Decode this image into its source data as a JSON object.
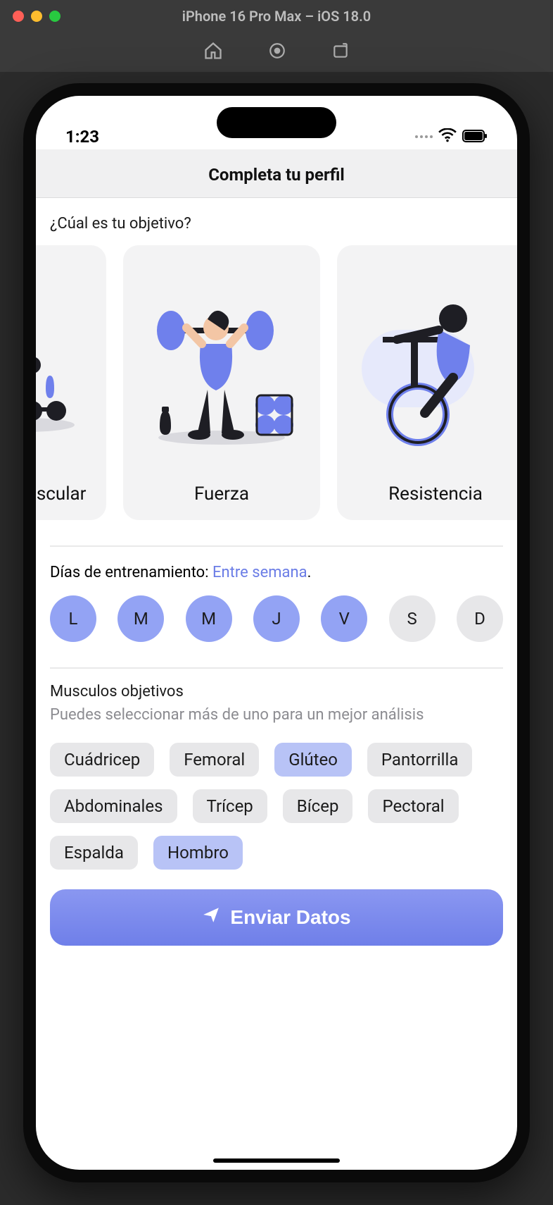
{
  "simulator": {
    "title": "iPhone 16 Pro Max – iOS 18.0"
  },
  "status": {
    "time": "1:23"
  },
  "header": {
    "title": "Completa tu perfil"
  },
  "objective": {
    "question": "¿Cúal es tu objetivo?",
    "cards": [
      {
        "label": "Ganancia muscular"
      },
      {
        "label": "Fuerza"
      },
      {
        "label": "Resistencia"
      }
    ]
  },
  "days": {
    "label_prefix": "Días de entrenamiento: ",
    "label_highlight": "Entre semana",
    "label_suffix": ".",
    "items": [
      {
        "letter": "L",
        "selected": true
      },
      {
        "letter": "M",
        "selected": true
      },
      {
        "letter": "M",
        "selected": true
      },
      {
        "letter": "J",
        "selected": true
      },
      {
        "letter": "V",
        "selected": true
      },
      {
        "letter": "S",
        "selected": false
      },
      {
        "letter": "D",
        "selected": false
      }
    ]
  },
  "muscles": {
    "title": "Musculos objetivos",
    "subtitle": "Puedes seleccionar más de uno para un mejor análisis",
    "items": [
      {
        "label": "Cuádricep",
        "selected": false
      },
      {
        "label": "Femoral",
        "selected": false
      },
      {
        "label": "Glúteo",
        "selected": true
      },
      {
        "label": "Pantorrilla",
        "selected": false
      },
      {
        "label": "Abdominales",
        "selected": false
      },
      {
        "label": "Trícep",
        "selected": false
      },
      {
        "label": "Bícep",
        "selected": false
      },
      {
        "label": "Pectoral",
        "selected": false
      },
      {
        "label": "Espalda",
        "selected": false
      },
      {
        "label": "Hombro",
        "selected": true
      }
    ]
  },
  "submit": {
    "label": "Enviar Datos"
  }
}
